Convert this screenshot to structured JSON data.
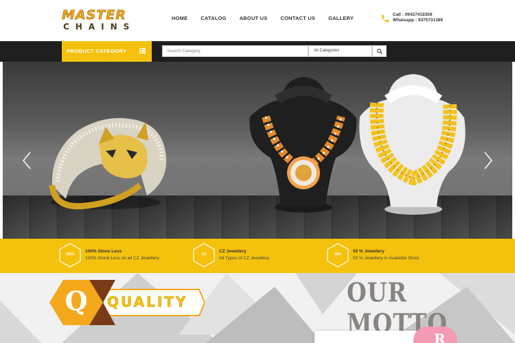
{
  "brand": {
    "logo_top": "MASTER",
    "logo_bottom": "CHAINS"
  },
  "nav": {
    "items": [
      "HOME",
      "CATALOG",
      "ABOUT US",
      "CONTACT US",
      "GALLERY"
    ]
  },
  "contact": {
    "call": "Call : 09427418359",
    "whatsapp": "Whatsapp : 9375731389"
  },
  "category_bar": {
    "button_label": "PRODUCT CATEGORY",
    "search_placeholder": "Search Category",
    "select_value": "All Categories"
  },
  "features": [
    {
      "badge": "100%",
      "title": "100% Stone Less",
      "desc": "100% Stone Less on all CZ Jewellery."
    },
    {
      "badge": "CZ",
      "title": "CZ Jewellery",
      "desc": "All Types of CZ Jewellery."
    },
    {
      "badge": "92%",
      "title": "92 % Jewellery",
      "desc": "92 % Jewellery in Available Stock."
    }
  ],
  "motto": {
    "quality_letter": "Q",
    "quality_word": "QUALITY",
    "title": "OUR MOTTO",
    "next_letter": "R"
  },
  "colors": {
    "accent_yellow": "#f4c20d",
    "dark_bar": "#1e1e1e",
    "logo_gold": "#f4a81c",
    "pink": "#f29bb3"
  },
  "icons": [
    "phone-icon",
    "menu-icon",
    "search-icon",
    "chevron-left-icon",
    "chevron-right-icon"
  ]
}
